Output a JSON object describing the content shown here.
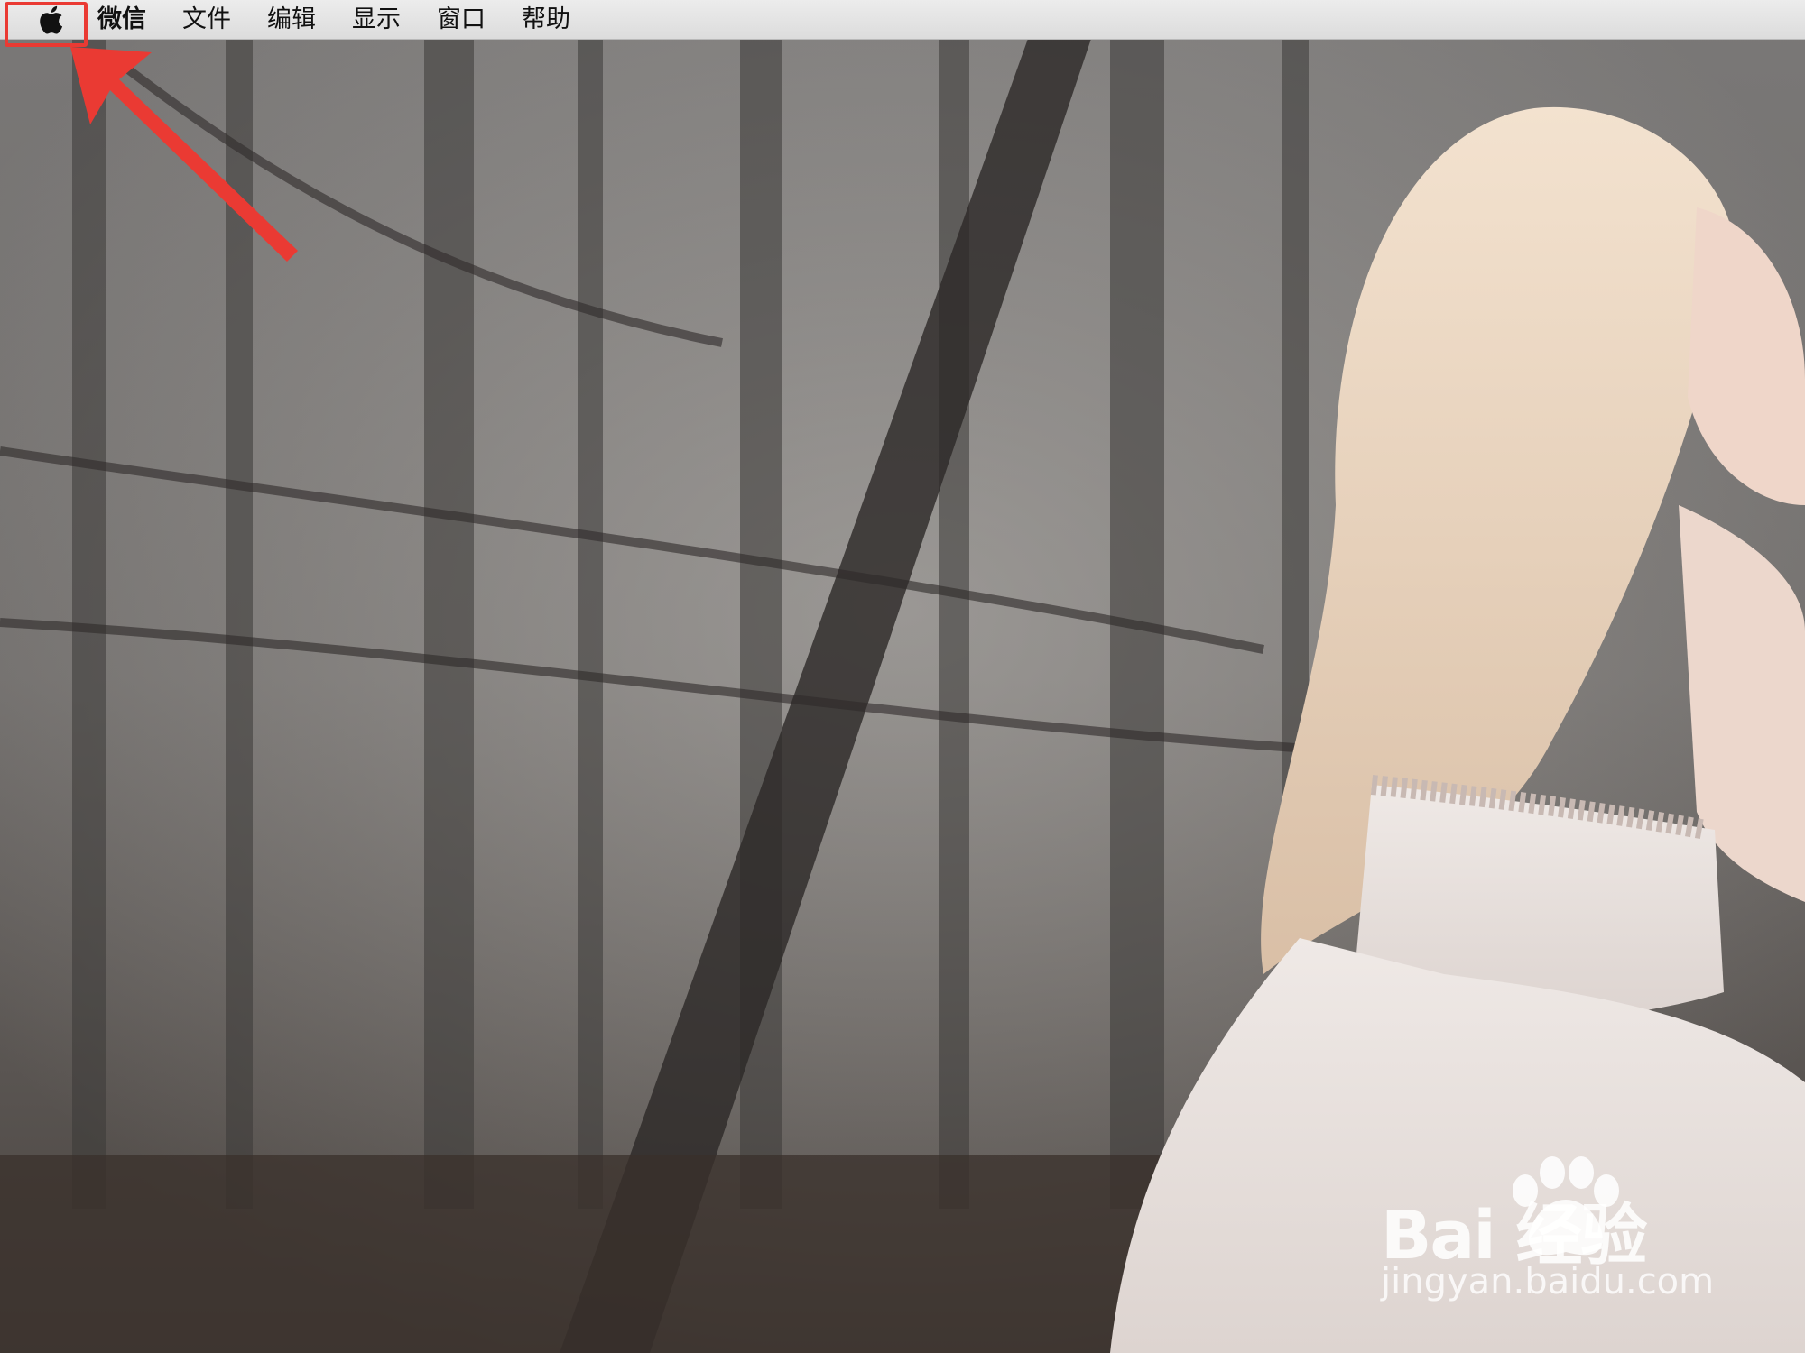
{
  "menubar": {
    "apple_icon": "apple-logo-icon",
    "app_name": "微信",
    "items": [
      "文件",
      "编辑",
      "显示",
      "窗口",
      "帮助"
    ]
  },
  "annotation": {
    "highlight_color": "#ea3a33",
    "arrow_color": "#ea3a33",
    "target": "apple-menu"
  },
  "watermark": {
    "brand": "Bai  经验",
    "url": "jingyan.baidu.com"
  }
}
